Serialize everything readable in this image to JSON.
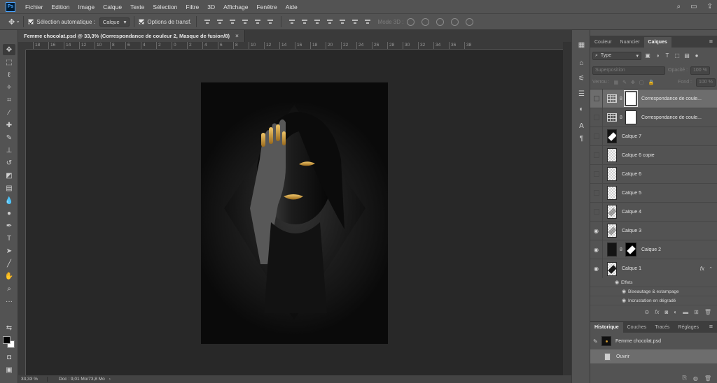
{
  "app": {
    "logo": "Ps"
  },
  "menu": [
    "Fichier",
    "Edition",
    "Image",
    "Calque",
    "Texte",
    "Sélection",
    "Filtre",
    "3D",
    "Affichage",
    "Fenêtre",
    "Aide"
  ],
  "options": {
    "auto_select_label": "Sélection automatique :",
    "auto_select_value": "Calque",
    "transform_label": "Options de transf.",
    "mode3d_label": "Mode 3D :"
  },
  "document": {
    "tab_title": "Femme chocolat.psd @ 33,3% (Correspondance de couleur 2, Masque de fusion/8)",
    "close_glyph": "×",
    "zoom": "33,33 %",
    "doc_size": "Doc : 9,01 Mo/73,8 Mo"
  },
  "ruler_h_labels": [
    "18",
    "16",
    "14",
    "12",
    "10",
    "8",
    "6",
    "4",
    "2",
    "0",
    "2",
    "4",
    "6",
    "8",
    "10",
    "12",
    "14",
    "16",
    "18",
    "20",
    "22",
    "24",
    "26",
    "28",
    "30",
    "32",
    "34",
    "36",
    "38"
  ],
  "panel_top": {
    "tabs": [
      "Couleur",
      "Nuancier",
      "Calques"
    ],
    "active_tab": "Calques"
  },
  "layers_panel": {
    "filter_label": "Type",
    "blend_mode": "Superposition",
    "opacity_label": "Opacité :",
    "opacity_value": "100 %",
    "lock_label": "Verrou :",
    "fill_label": "Fond :",
    "fill_value": "100 %",
    "effects_label": "Effets",
    "effect_1": "Biseautage & estampage",
    "effect_2": "Incrustation en dégradé",
    "fx_label": "fx"
  },
  "layers": [
    {
      "name": "Correspondance de coule...",
      "kind": "adjustment",
      "visible": false,
      "selected": true
    },
    {
      "name": "Correspondance de coule...",
      "kind": "adjustment",
      "visible": false,
      "selected": false
    },
    {
      "name": "Calque 7",
      "kind": "pixel-dark",
      "visible": false
    },
    {
      "name": "Calque 6 copie",
      "kind": "pixel",
      "visible": false
    },
    {
      "name": "Calque 6",
      "kind": "pixel",
      "visible": false
    },
    {
      "name": "Calque 5",
      "kind": "pixel",
      "visible": false
    },
    {
      "name": "Calque 4",
      "kind": "pixel-outline",
      "visible": false
    },
    {
      "name": "Calque 3",
      "kind": "pixel-outline",
      "visible": true
    },
    {
      "name": "Calque 2",
      "kind": "photo-with-mask",
      "visible": true
    },
    {
      "name": "Calque 1",
      "kind": "pixel-fx",
      "visible": true
    }
  ],
  "panel_bottom": {
    "tabs": [
      "Historique",
      "Couches",
      "Tracés",
      "Réglages"
    ],
    "active_tab": "Historique"
  },
  "history": {
    "snapshot": "Femme chocolat.psd",
    "step_1": "Ouvrir"
  },
  "colors": {
    "accent": "#4aa3ff",
    "gold": "#c9952f",
    "panel_bg": "#535353",
    "canvas_bg": "#282828"
  }
}
